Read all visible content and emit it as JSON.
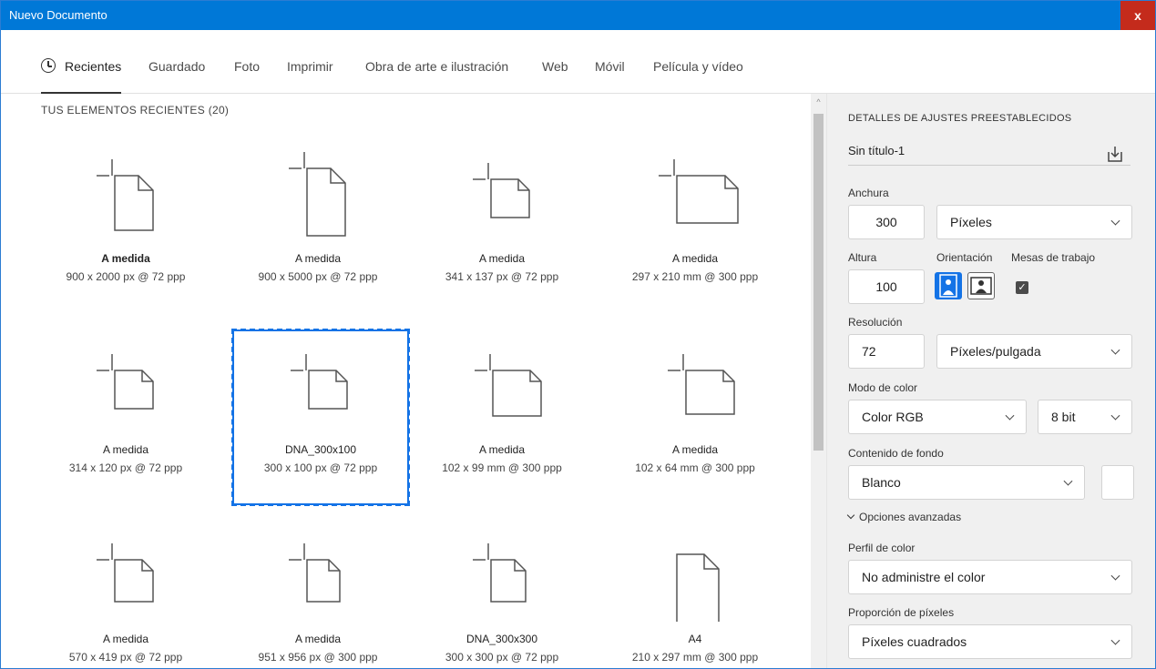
{
  "window": {
    "title": "Nuevo Documento",
    "close_label": "x"
  },
  "tabs": [
    {
      "label": "Recientes"
    },
    {
      "label": "Guardado"
    },
    {
      "label": "Foto"
    },
    {
      "label": "Imprimir"
    },
    {
      "label": "Obra de arte e ilustración"
    },
    {
      "label": "Web"
    },
    {
      "label": "Móvil"
    },
    {
      "label": "Película y vídeo"
    }
  ],
  "recent": {
    "title": "TUS ELEMENTOS RECIENTES",
    "count": "(20)",
    "items": [
      {
        "name": "A medida",
        "dims": "900 x 2000 px @ 72 ppp",
        "icon": "custom-tall-document-icon"
      },
      {
        "name": "A medida",
        "dims": "900 x 5000 px @ 72 ppp",
        "icon": "custom-tall-document-icon"
      },
      {
        "name": "A medida",
        "dims": "341 x 137 px @ 72 ppp",
        "icon": "custom-wide-document-icon"
      },
      {
        "name": "A medida",
        "dims": "297 x 210 mm @ 300 ppp",
        "icon": "custom-landscape-document-icon"
      },
      {
        "name": "A medida",
        "dims": "314 x 120 px @ 72 ppp",
        "icon": "custom-wide-document-icon"
      },
      {
        "name": "DNA_300x100",
        "dims": "300 x 100 px @ 72 ppp",
        "icon": "custom-wide-document-icon"
      },
      {
        "name": "A medida",
        "dims": "102 x 99 mm @ 300 ppp",
        "icon": "custom-landscape-document-icon"
      },
      {
        "name": "A medida",
        "dims": "102 x 64 mm @ 300 ppp",
        "icon": "custom-landscape-document-icon"
      },
      {
        "name": "A medida",
        "dims": "570 x 419 px @ 72 ppp",
        "icon": "custom-wide-document-icon"
      },
      {
        "name": "A medida",
        "dims": "951 x 956 px @ 300 ppp",
        "icon": "custom-square-document-icon"
      },
      {
        "name": "DNA_300x300",
        "dims": "300 x 300 px @ 72 ppp",
        "icon": "custom-square-document-icon"
      },
      {
        "name": "A4",
        "dims": "210 x 297 mm @ 300 ppp",
        "icon": "portrait-document-icon"
      }
    ]
  },
  "details": {
    "heading": "DETALLES DE AJUSTES PREESTABLECIDOS",
    "doc_name": "Sin título-1",
    "width_label": "Anchura",
    "width_value": "300",
    "width_unit": "Píxeles",
    "height_label": "Altura",
    "height_value": "100",
    "orientation_label": "Orientación",
    "artboards_label": "Mesas de trabajo",
    "artboards_checked": true,
    "resolution_label": "Resolución",
    "resolution_value": "72",
    "resolution_unit": "Píxeles/pulgada",
    "color_mode_label": "Modo de color",
    "color_mode_value": "Color RGB",
    "bit_depth_value": "8 bit",
    "background_label": "Contenido de fondo",
    "background_value": "Blanco",
    "background_swatch_color": "#ffffff",
    "advanced_label": "Opciones avanzadas",
    "color_profile_label": "Perfil de color",
    "color_profile_value": "No administre el color",
    "pixel_aspect_label": "Proporción de píxeles",
    "pixel_aspect_value": "Píxeles cuadrados"
  },
  "colors": {
    "accent": "#1473e6",
    "titlebar": "#0078d7",
    "close": "#c42b1c"
  }
}
